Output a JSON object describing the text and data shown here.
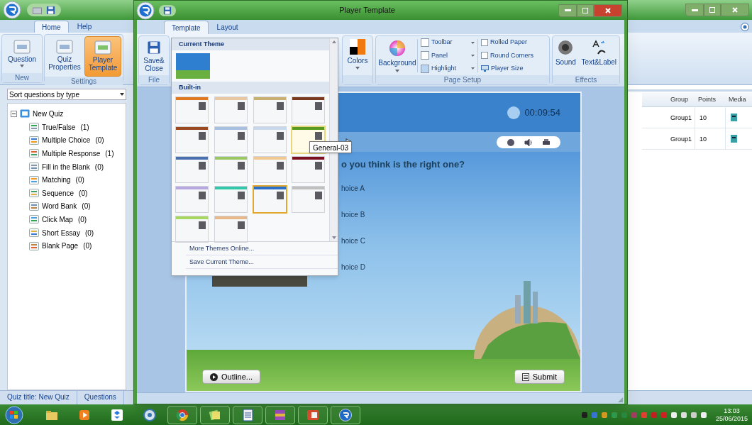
{
  "main_window": {
    "tabs": [
      {
        "label": "Home",
        "selected": true
      },
      {
        "label": "Help",
        "selected": false
      }
    ],
    "ribbon_groups": [
      {
        "label": "New",
        "buttons": [
          {
            "label": "Question",
            "dropdown": true,
            "selected": false
          }
        ]
      },
      {
        "label": "Settings",
        "buttons": [
          {
            "label": "Quiz Properties",
            "dropdown": false,
            "selected": false
          },
          {
            "label": "Player Template",
            "dropdown": false,
            "selected": true
          }
        ]
      }
    ],
    "sort_select": {
      "value": "Sort questions by type"
    },
    "tree": {
      "label": "New Quiz",
      "expanded": true,
      "children": [
        {
          "label": "True/False",
          "count": "(1)"
        },
        {
          "label": "Multiple Choice",
          "count": "(0)"
        },
        {
          "label": "Multiple Response",
          "count": "(1)"
        },
        {
          "label": "Fill in the Blank",
          "count": "(0)"
        },
        {
          "label": "Matching",
          "count": "(0)"
        },
        {
          "label": "Sequence",
          "count": "(0)"
        },
        {
          "label": "Word Bank",
          "count": "(0)"
        },
        {
          "label": "Click Map",
          "count": "(0)"
        },
        {
          "label": "Short Essay",
          "count": "(0)"
        },
        {
          "label": "Blank Page",
          "count": "(0)"
        }
      ]
    },
    "table": {
      "columns": [
        "Group",
        "Points",
        "Media"
      ],
      "rows": [
        {
          "group": "Group1",
          "points": "10"
        },
        {
          "group": "Group1",
          "points": "10"
        }
      ]
    },
    "status_bar": [
      "Quiz title: New Quiz",
      "Questions"
    ]
  },
  "player_window": {
    "title": "Player Template",
    "tabs": [
      {
        "label": "Template",
        "selected": true
      },
      {
        "label": "Layout",
        "selected": false
      }
    ],
    "file_group": {
      "label": "File",
      "button": "Save& Close"
    },
    "colors_button": "Colors",
    "page_setup": {
      "label": "Page Setup",
      "background_button": "Background",
      "swatches": [
        {
          "label": "Toolbar",
          "color": "#ffffff"
        },
        {
          "label": "Panel",
          "color": "#ffffff"
        },
        {
          "label": "Highlight",
          "color": "#b9d5f2"
        }
      ],
      "checkboxes": [
        {
          "label": "Rolled Paper",
          "checked": false
        },
        {
          "label": "Round Corners",
          "checked": false
        }
      ],
      "player_size_button": "Player Size"
    },
    "effects": {
      "label": "Effects",
      "buttons": [
        "Sound",
        "Text&Label"
      ]
    },
    "preview": {
      "timer": "00:09:54",
      "question": "o you think is the right one?",
      "choices": [
        "hoice A",
        "hoice B",
        "hoice C",
        "hoice D"
      ],
      "outline_button": "Outline...",
      "submit_button": "Submit"
    }
  },
  "theme_menu": {
    "current_header": "Current Theme",
    "builtin_header": "Built-in",
    "themes": [
      {
        "color": "#e07820",
        "selected": false,
        "hovered": false
      },
      {
        "color": "#e8c8a0",
        "selected": false,
        "hovered": false
      },
      {
        "color": "#c8b070",
        "selected": false,
        "hovered": false
      },
      {
        "color": "#7a3a20",
        "selected": false,
        "hovered": false
      },
      {
        "color": "#9a4a20",
        "selected": false,
        "hovered": false
      },
      {
        "color": "#a8c0e0",
        "selected": false,
        "hovered": false
      },
      {
        "color": "#c8d8ec",
        "selected": false,
        "hovered": false
      },
      {
        "color": "#5a9a20",
        "selected": false,
        "hovered": true
      },
      {
        "color": "#4a70b0",
        "selected": false,
        "hovered": false
      },
      {
        "color": "#9ac860",
        "selected": false,
        "hovered": false
      },
      {
        "color": "#f0c890",
        "selected": false,
        "hovered": false
      },
      {
        "color": "#7a1020",
        "selected": false,
        "hovered": false
      },
      {
        "color": "#b8a8e0",
        "selected": false,
        "hovered": false
      },
      {
        "color": "#30c8a8",
        "selected": false,
        "hovered": false
      },
      {
        "color": "#2a70c8",
        "selected": true,
        "hovered": false
      },
      {
        "color": "#c0c0c0",
        "selected": false,
        "hovered": false
      },
      {
        "color": "#a8d860",
        "selected": false,
        "hovered": false
      },
      {
        "color": "#e8b888",
        "selected": false,
        "hovered": false
      }
    ],
    "tooltip": "General-03",
    "menu_items": [
      "More Themes Online...",
      "Save Current Theme..."
    ]
  },
  "taskbar": {
    "apps": [
      {
        "kind": "folder",
        "running": false
      },
      {
        "kind": "player",
        "running": false
      },
      {
        "kind": "box",
        "running": false
      },
      {
        "kind": "disc",
        "running": false
      },
      {
        "kind": "browser",
        "running": true
      },
      {
        "kind": "notes",
        "running": true
      },
      {
        "kind": "document",
        "running": true
      },
      {
        "kind": "archive",
        "running": true
      },
      {
        "kind": "slides",
        "running": true
      },
      {
        "kind": "quiz",
        "running": true
      }
    ],
    "time": "13:03",
    "date": "25/06/2015"
  }
}
